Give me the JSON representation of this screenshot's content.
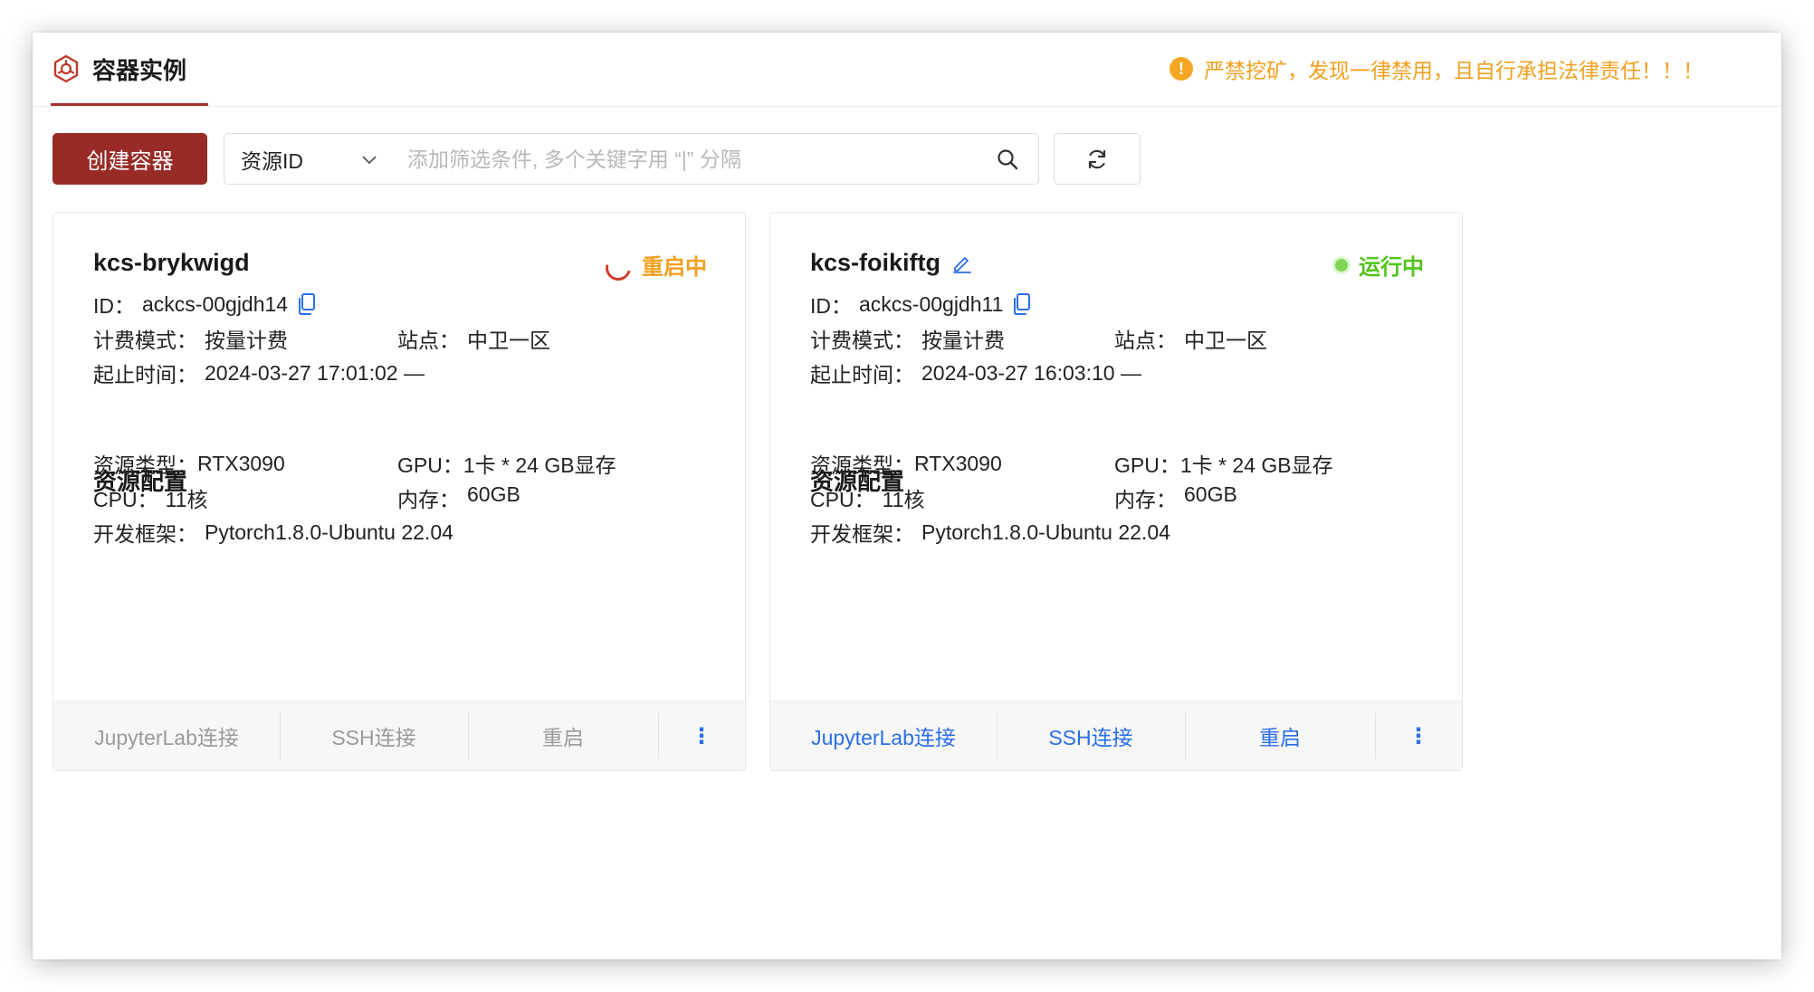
{
  "header": {
    "title": "容器实例",
    "title_icon": "container-logo-icon",
    "warning": "严禁挖矿，发现一律禁用，且自行承担法律责任！！！",
    "warning_icon": "exclamation-circle-icon"
  },
  "toolbar": {
    "create_label": "创建容器",
    "filter_field": "资源ID",
    "search_placeholder": "添加筛选条件, 多个关键字用 “|” 分隔",
    "search_value": ""
  },
  "instances": [
    {
      "name": "kcs-brykwigd",
      "status": "重启中",
      "status_color": "#f0a020",
      "id_label": "ID：",
      "id": "ackcs-00gjdh14",
      "billing_label": "计费模式：",
      "billing": "按量计费",
      "site_label": "站点：",
      "site": "中卫一区",
      "time_label": "起止时间：",
      "time": "2024-03-27 17:01:02 —",
      "section_title": "资源配置",
      "type_label": "资源类型：",
      "type": "RTX3090",
      "gpu_label": "GPU：",
      "gpu": "1卡 * 24 GB显存",
      "cpu_label": "CPU：",
      "cpu": "11核",
      "mem_label": "内存：",
      "mem": "60GB",
      "framework_label": "开发框架：",
      "framework": "Pytorch1.8.0-Ubuntu 22.04",
      "actions": [
        "JupyterLab连接",
        "SSH连接",
        "重启",
        "⋮"
      ]
    },
    {
      "name": "kcs-foikiftg",
      "status": "运行中",
      "status_color": "#52c41a",
      "id_label": "ID：",
      "id": "ackcs-00gjdh11",
      "billing_label": "计费模式：",
      "billing": "按量计费",
      "site_label": "站点：",
      "site": "中卫一区",
      "time_label": "起止时间：",
      "time": "2024-03-27 16:03:10 —",
      "section_title": "资源配置",
      "type_label": "资源类型：",
      "type": "RTX3090",
      "gpu_label": "GPU：",
      "gpu": "1卡 * 24 GB显存",
      "cpu_label": "CPU：",
      "cpu": "11核",
      "mem_label": "内存：",
      "mem": "60GB",
      "framework_label": "开发框架：",
      "framework": "Pytorch1.8.0-Ubuntu 22.04",
      "actions": [
        "JupyterLab连接",
        "SSH连接",
        "重启",
        "⋮"
      ]
    }
  ],
  "colors": {
    "brand": "#992b27",
    "link": "#2a6fe8",
    "warning": "#f0a020",
    "running": "#52c41a"
  }
}
